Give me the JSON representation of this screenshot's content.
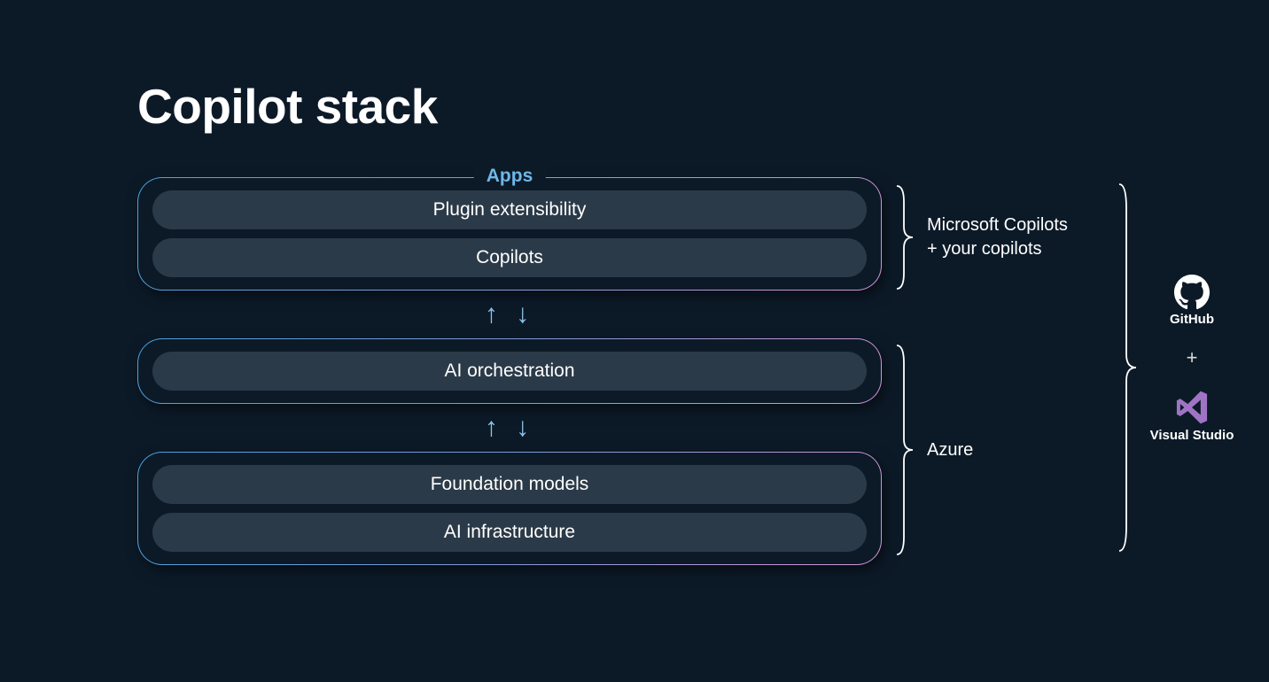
{
  "title": "Copilot stack",
  "layers": {
    "apps": {
      "label": "Apps",
      "items": [
        "Plugin extensibility",
        "Copilots"
      ]
    },
    "orchestration": {
      "items": [
        "AI orchestration"
      ]
    },
    "foundation": {
      "items": [
        "Foundation models",
        "AI infrastructure"
      ]
    }
  },
  "brackets": {
    "top": "Microsoft Copilots\n+ your copilots",
    "bottom": "Azure"
  },
  "right": {
    "github": "GitHub",
    "plus": "+",
    "vs": "Visual Studio"
  }
}
